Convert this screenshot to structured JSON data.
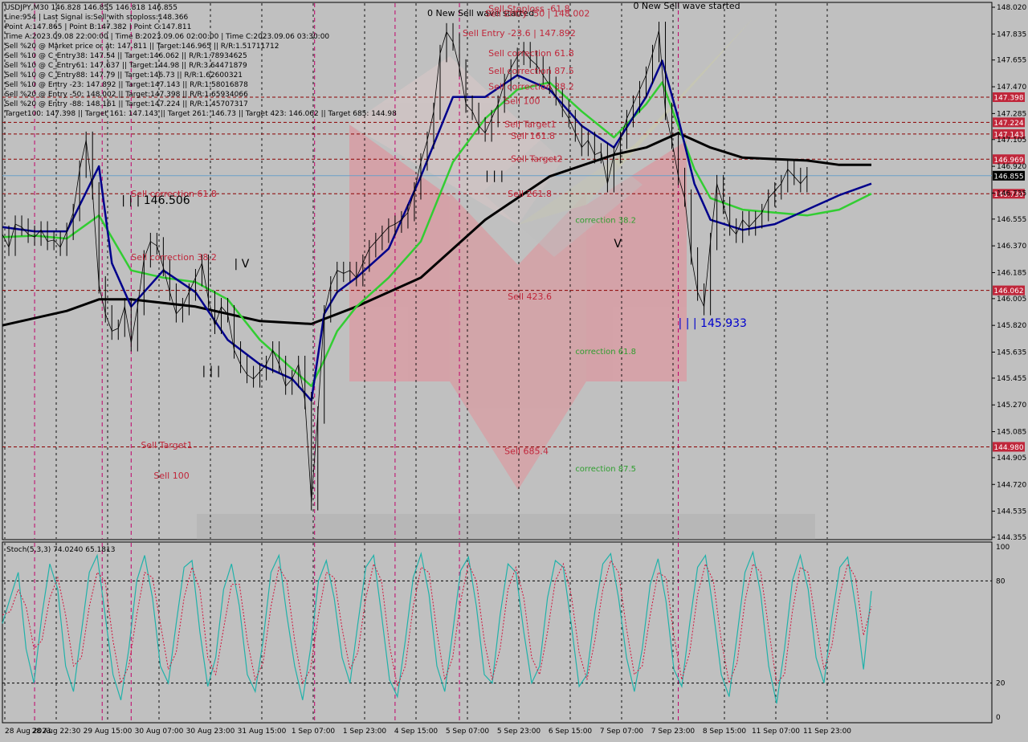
{
  "symbol_header": "USDJPY,M30  146.828 146.855 146.818 146.855",
  "info_lines": [
    "Line:954 | Last Signal is:Sell with stoploss:148.366",
    "Point A:147.865 | Point B:147.382 | Point C:147.811",
    "Time A:2023.09.08 22:00:00 | Time B:2023.09.06 02:00:00 | Time C:2023.09.06 03:30:00",
    "Sell %20 @ Market price or at: 147.811 || Target:146.965 || R/R:1.51711712",
    "Sell %10 @ C_Entry38: 147.54 || Target:146.062 || R/R:1.78934625",
    "Sell %10 @ C_Entry61: 147.637 || Target:144.98 || R/R:3.64471879",
    "Sell %10 @ C_Entry88: 147.79 || Target:146.73 || R/R:1.62600321",
    "Sell %10 @ Entry -23: 147.892 || Target:147.143 || R/R:1.58016878",
    "Sell %20 @ Entry -50: 148.002 || Target:147.398 || R/R:1.65934066",
    "Sell %20 @ Entry -88: 148.161 || Target:147.224 || R/R:1.45707317",
    "Target100: 147.398 || Target 161: 147.143 || Target 261: 146.73 || Target 423: 146.062 || Target 685: 144.98"
  ],
  "colors": {
    "background": "#c0c0c0",
    "level_line": "#8b0000",
    "price_tag_bg": "#c0263a",
    "current_tag_bg": "#000000",
    "sell_text": "#c0263a",
    "correction_text": "#2e9e2e",
    "ma_fast": "#00008b",
    "ma_mid": "#32cd32",
    "ma_slow": "#000000",
    "stoch_main": "#20b2aa",
    "stoch_signal": "#d2143c",
    "current_line": "#6aa0c8"
  },
  "chart_data": {
    "type": "line",
    "symbol": "USDJPY",
    "timeframe": "M30",
    "ylim": [
      144.355,
      148.02
    ],
    "y_ticks": [
      148.02,
      147.835,
      147.655,
      147.47,
      147.285,
      147.105,
      146.92,
      146.735,
      146.555,
      146.37,
      146.185,
      146.005,
      145.82,
      145.635,
      145.455,
      145.27,
      145.085,
      144.905,
      144.72,
      144.535,
      144.355
    ],
    "x_ticks": [
      "28 Aug 2023",
      "28 Aug 22:30",
      "29 Aug 15:00",
      "30 Aug 07:00",
      "30 Aug 23:00",
      "31 Aug 15:00",
      "1 Sep 07:00",
      "1 Sep 23:00",
      "4 Sep 15:00",
      "5 Sep 07:00",
      "5 Sep 23:00",
      "6 Sep 15:00",
      "7 Sep 07:00",
      "7 Sep 23:00",
      "8 Sep 15:00",
      "11 Sep 07:00",
      "11 Sep 23:00"
    ],
    "levels": [
      {
        "value": 147.398,
        "label": "147.398"
      },
      {
        "value": 147.224,
        "label": "147.224"
      },
      {
        "value": 147.143,
        "label": "147.143"
      },
      {
        "value": 146.969,
        "label": "146.969"
      },
      {
        "value": 146.73,
        "label": "146.730"
      },
      {
        "value": 146.062,
        "label": "146.062"
      },
      {
        "value": 144.98,
        "label": "144.980"
      }
    ],
    "current_price": {
      "value": 146.855,
      "label": "146.855"
    },
    "price_series": {
      "name": "USDJPY",
      "x": [
        0,
        2,
        4,
        6,
        8,
        10,
        12,
        14,
        16,
        18,
        20,
        22,
        24,
        26,
        28,
        30,
        32,
        34,
        36,
        38,
        40,
        42,
        44,
        46,
        48,
        50,
        52,
        54,
        56,
        58,
        60,
        62,
        64,
        66,
        68,
        70,
        72,
        74,
        76,
        78,
        80,
        82,
        84,
        86,
        88,
        90,
        92,
        94,
        96,
        98,
        100,
        102,
        104,
        106,
        108,
        110,
        112,
        114,
        116,
        118,
        120,
        122,
        124,
        126,
        128,
        130,
        132,
        134,
        136,
        138,
        140,
        142,
        144,
        146,
        148,
        150,
        152,
        154,
        156,
        158,
        160,
        162,
        164,
        166,
        168,
        170,
        172,
        174,
        176,
        178,
        180,
        182,
        184,
        186,
        188,
        190,
        192,
        194,
        196,
        198,
        200,
        202,
        204,
        206,
        208,
        210,
        212,
        214,
        216,
        218,
        220,
        222,
        224,
        226,
        228,
        230,
        232,
        234,
        236,
        238,
        240,
        242,
        244,
        246,
        248,
        250,
        252,
        254,
        256,
        258,
        260,
        262,
        264,
        266,
        268,
        270
      ],
      "values": [
        146.45,
        146.36,
        146.52,
        146.5,
        146.45,
        146.43,
        146.48,
        146.4,
        146.41,
        146.36,
        146.47,
        146.6,
        146.9,
        147.1,
        146.75,
        146.1,
        145.9,
        145.78,
        145.8,
        145.95,
        145.7,
        145.95,
        146.28,
        146.4,
        146.37,
        146.22,
        146.05,
        145.9,
        145.95,
        146.05,
        146.15,
        146.25,
        146.0,
        145.82,
        145.95,
        145.9,
        145.65,
        145.55,
        145.48,
        145.45,
        145.5,
        145.55,
        145.65,
        145.55,
        145.4,
        145.45,
        145.55,
        145.3,
        144.6,
        145.2,
        145.9,
        146.1,
        146.2,
        146.18,
        146.2,
        146.15,
        146.25,
        146.35,
        146.4,
        146.45,
        146.5,
        146.52,
        146.55,
        146.6,
        146.75,
        146.95,
        147.1,
        147.3,
        147.7,
        147.85,
        147.78,
        147.6,
        147.35,
        147.3,
        147.2,
        147.15,
        147.25,
        147.35,
        147.5,
        147.6,
        147.68,
        147.72,
        147.66,
        147.62,
        147.55,
        147.48,
        147.4,
        147.32,
        147.25,
        147.15,
        147.05,
        147.1,
        147.0,
        147.02,
        146.8,
        147.0,
        147.1,
        147.25,
        147.35,
        147.45,
        147.55,
        147.7,
        147.86,
        147.3,
        147.1,
        146.85,
        146.7,
        146.3,
        146.05,
        145.95,
        146.4,
        146.8,
        146.65,
        146.5,
        146.45,
        146.55,
        146.5,
        146.55,
        146.6,
        146.7,
        146.75,
        146.8,
        146.9,
        146.85,
        146.8,
        146.855
      ]
    },
    "ma_fast": {
      "name": "",
      "x": [
        0,
        10,
        20,
        30,
        34,
        40,
        50,
        60,
        70,
        80,
        90,
        96,
        100,
        104,
        110,
        120,
        130,
        140,
        150,
        160,
        170,
        180,
        190,
        200,
        205,
        210,
        215,
        220,
        230,
        240,
        250,
        260,
        270
      ],
      "values": [
        146.5,
        146.47,
        146.47,
        146.92,
        146.25,
        145.95,
        146.2,
        146.05,
        145.72,
        145.55,
        145.45,
        145.3,
        145.9,
        146.05,
        146.15,
        146.35,
        146.85,
        147.4,
        147.4,
        147.55,
        147.45,
        147.2,
        147.05,
        147.4,
        147.65,
        147.25,
        146.8,
        146.55,
        146.48,
        146.52,
        146.62,
        146.72,
        146.8
      ]
    },
    "ma_mid": {
      "name": "",
      "x": [
        0,
        10,
        20,
        30,
        40,
        50,
        60,
        70,
        80,
        90,
        96,
        100,
        104,
        110,
        120,
        130,
        140,
        150,
        160,
        170,
        180,
        190,
        200,
        205,
        210,
        215,
        220,
        230,
        240,
        250,
        260,
        270
      ],
      "values": [
        146.43,
        146.44,
        146.42,
        146.58,
        146.2,
        146.15,
        146.12,
        146.0,
        145.72,
        145.52,
        145.4,
        145.58,
        145.78,
        145.95,
        146.15,
        146.4,
        146.95,
        147.25,
        147.45,
        147.5,
        147.3,
        147.12,
        147.35,
        147.5,
        147.2,
        146.9,
        146.7,
        146.62,
        146.6,
        146.58,
        146.62,
        146.73
      ]
    },
    "ma_slow": {
      "name": "",
      "x": [
        0,
        20,
        30,
        40,
        60,
        80,
        96,
        110,
        130,
        150,
        170,
        190,
        200,
        210,
        220,
        230,
        240,
        250,
        260,
        270
      ],
      "values": [
        145.82,
        145.92,
        146.0,
        146.0,
        145.95,
        145.85,
        145.83,
        145.95,
        146.15,
        146.55,
        146.85,
        147.0,
        147.05,
        147.15,
        147.05,
        146.98,
        146.97,
        146.96,
        146.93,
        146.93
      ]
    },
    "pink_lines_x": [
      10,
      31,
      40,
      97,
      122,
      142,
      210
    ],
    "annotations": [
      {
        "text": "0 New Sell wave started",
        "price": 148.01,
        "x": 196
      },
      {
        "text": "0 New Sell wave started",
        "price": 147.96,
        "x": 132
      },
      {
        "text": "Sell Stoploss -61.8",
        "price": 147.99,
        "x": 151
      },
      {
        "text": "Sell Entry -50 | 148.002",
        "price": 147.955,
        "x": 150
      },
      {
        "text": "Sell Entry -23.6 | 147.892",
        "price": 147.82,
        "x": 143
      },
      {
        "text": "Sell correction 61.8",
        "price": 147.68,
        "x": 151
      },
      {
        "text": "Sell correction 87.5",
        "price": 147.56,
        "x": 151
      },
      {
        "text": "Sell correction 38.2",
        "price": 147.45,
        "x": 151
      },
      {
        "text": "Sell 100",
        "price": 147.35,
        "x": 156
      },
      {
        "text": "Sell Target1",
        "price": 147.19,
        "x": 156
      },
      {
        "text": "Sell 161.8",
        "price": 147.11,
        "x": 158
      },
      {
        "text": "Sell Target2",
        "price": 146.95,
        "x": 158
      },
      {
        "text": "Sell 261.8",
        "price": 146.71,
        "x": 157
      },
      {
        "text": "correction 38.2",
        "price": 146.53,
        "x": 178
      },
      {
        "text": "Sell 423.6",
        "price": 146.0,
        "x": 157
      },
      {
        "text": "correction 61.8",
        "price": 145.62,
        "x": 178
      },
      {
        "text": "Sell 685.4",
        "price": 144.93,
        "x": 156
      },
      {
        "text": "correction 87.5",
        "price": 144.81,
        "x": 178
      },
      {
        "text": "Sell correction 61.8",
        "price": 146.71,
        "x": 40
      },
      {
        "text": "Sell correction 38.2",
        "price": 146.27,
        "x": 40
      },
      {
        "text": "Sell Target1",
        "price": 144.97,
        "x": 43
      },
      {
        "text": "Sell 100",
        "price": 144.76,
        "x": 47
      }
    ],
    "big_labels": [
      {
        "text": "| | | 146.506",
        "price": 146.66,
        "x": 37,
        "color": "#000000"
      },
      {
        "text": "| | | 145.933",
        "price": 145.81,
        "x": 210,
        "color": "#0000cd"
      },
      {
        "text": "| | |",
        "price": 145.48,
        "x": 62,
        "color": "#000000"
      },
      {
        "text": "| | |",
        "price": 146.83,
        "x": 150,
        "color": "#000000"
      },
      {
        "text": "| V",
        "price": 146.22,
        "x": 72,
        "color": "#000000"
      },
      {
        "text": "V",
        "price": 146.36,
        "x": 190,
        "color": "#000000"
      }
    ],
    "stoch": {
      "label": "Stoch(5,3,3) 74.0240 65.1813",
      "ylim": [
        0,
        100
      ],
      "y_ticks": [
        100,
        80,
        20,
        0
      ],
      "main": [
        55,
        70,
        85,
        40,
        20,
        60,
        90,
        75,
        30,
        15,
        50,
        85,
        95,
        60,
        25,
        10,
        40,
        80,
        95,
        70,
        30,
        20,
        55,
        88,
        92,
        50,
        18,
        35,
        75,
        90,
        65,
        25,
        15,
        45,
        85,
        95,
        60,
        30,
        10,
        40,
        80,
        92,
        70,
        35,
        20,
        55,
        88,
        95,
        60,
        22,
        12,
        45,
        82,
        96,
        72,
        30,
        15,
        50,
        86,
        94,
        65,
        25,
        20,
        60,
        90,
        85,
        50,
        20,
        30,
        70,
        92,
        88,
        55,
        18,
        25,
        62,
        90,
        96,
        70,
        35,
        15,
        40,
        78,
        93,
        68,
        28,
        18,
        55,
        88,
        95,
        62,
        25,
        12,
        48,
        85,
        97,
        72,
        30,
        8,
        40,
        80,
        95,
        75,
        35,
        20,
        58,
        88,
        94,
        65,
        28,
        74
      ],
      "signal": [
        60,
        62,
        75,
        65,
        40,
        45,
        70,
        82,
        60,
        30,
        35,
        65,
        85,
        80,
        45,
        20,
        30,
        60,
        85,
        82,
        55,
        28,
        38,
        70,
        88,
        75,
        35,
        25,
        52,
        78,
        78,
        45,
        22,
        32,
        65,
        88,
        80,
        45,
        20,
        28,
        60,
        85,
        82,
        52,
        28,
        38,
        70,
        90,
        80,
        42,
        18,
        30,
        65,
        88,
        85,
        50,
        22,
        35,
        68,
        90,
        80,
        45,
        22,
        40,
        75,
        88,
        70,
        35,
        25,
        50,
        80,
        90,
        72,
        38,
        22,
        45,
        75,
        92,
        85,
        52,
        25,
        30,
        60,
        85,
        82,
        48,
        22,
        38,
        72,
        90,
        80,
        45,
        20,
        32,
        68,
        90,
        85,
        52,
        20,
        25,
        62,
        88,
        85,
        55,
        28,
        42,
        72,
        90,
        82,
        48,
        65
      ]
    }
  }
}
